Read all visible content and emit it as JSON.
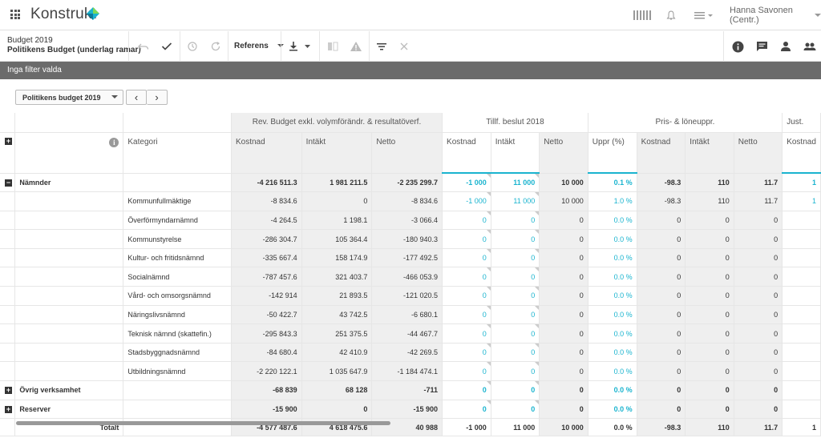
{
  "app": {
    "logo": "Konstrukt",
    "user": "Hanna Savonen (Centr.)"
  },
  "toolbar": {
    "title": "Budget 2019",
    "subtitle": "Politikens Budget (underlag ramar)",
    "referens": "Referens"
  },
  "filter": {
    "text": "Inga filter valda"
  },
  "selector": {
    "value": "Politikens budget 2019",
    "prev": "‹",
    "next": "›"
  },
  "table": {
    "category_header": "Kategori",
    "groups": [
      {
        "label": "Rev. Budget exkl. volymförändr. & resultatöverf."
      },
      {
        "label": "Tillf. beslut 2018"
      },
      {
        "label": "Pris- & löneuppr."
      },
      {
        "label": "Just."
      }
    ],
    "columns": [
      "Kostnad",
      "Intäkt",
      "Netto",
      "Kostnad",
      "Intäkt",
      "Netto",
      "Uppr (%)",
      "Kostnad",
      "Intäkt",
      "Netto",
      "Kostnad"
    ],
    "rows": [
      {
        "type": "group",
        "expand": "−",
        "label": "Nämnder",
        "cat": "",
        "values": [
          "-4 216 511.3",
          "1 981 211.5",
          "-2 235 299.7",
          "-1 000",
          "11 000",
          "10 000",
          "0.1 %",
          "-98.3",
          "110",
          "11.7",
          "1"
        ]
      },
      {
        "type": "child",
        "label": "",
        "cat": "Kommunfullmäktige",
        "values": [
          "-8 834.6",
          "0",
          "-8 834.6",
          "-1 000",
          "11 000",
          "10 000",
          "1.0 %",
          "-98.3",
          "110",
          "11.7",
          "1"
        ]
      },
      {
        "type": "child",
        "label": "",
        "cat": "Överförmyndarnämnd",
        "values": [
          "-4 264.5",
          "1 198.1",
          "-3 066.4",
          "0",
          "0",
          "0",
          "0.0 %",
          "0",
          "0",
          "0",
          ""
        ]
      },
      {
        "type": "child",
        "label": "",
        "cat": "Kommunstyrelse",
        "values": [
          "-286 304.7",
          "105 364.4",
          "-180 940.3",
          "0",
          "0",
          "0",
          "0.0 %",
          "0",
          "0",
          "0",
          ""
        ]
      },
      {
        "type": "child",
        "label": "",
        "cat": "Kultur- och fritidsnämnd",
        "values": [
          "-335 667.4",
          "158 174.9",
          "-177 492.5",
          "0",
          "0",
          "0",
          "0.0 %",
          "0",
          "0",
          "0",
          ""
        ]
      },
      {
        "type": "child",
        "label": "",
        "cat": "Socialnämnd",
        "values": [
          "-787 457.6",
          "321 403.7",
          "-466 053.9",
          "0",
          "0",
          "0",
          "0.0 %",
          "0",
          "0",
          "0",
          ""
        ]
      },
      {
        "type": "child",
        "label": "",
        "cat": "Vård- och omsorgsnämnd",
        "values": [
          "-142 914",
          "21 893.5",
          "-121 020.5",
          "0",
          "0",
          "0",
          "0.0 %",
          "0",
          "0",
          "0",
          ""
        ]
      },
      {
        "type": "child",
        "label": "",
        "cat": "Näringslivsnämnd",
        "values": [
          "-50 422.7",
          "43 742.5",
          "-6 680.1",
          "0",
          "0",
          "0",
          "0.0 %",
          "0",
          "0",
          "0",
          ""
        ]
      },
      {
        "type": "child",
        "label": "",
        "cat": "Teknisk nämnd (skattefin.)",
        "values": [
          "-295 843.3",
          "251 375.5",
          "-44 467.7",
          "0",
          "0",
          "0",
          "0.0 %",
          "0",
          "0",
          "0",
          ""
        ]
      },
      {
        "type": "child",
        "label": "",
        "cat": "Stadsbyggnadsnämnd",
        "values": [
          "-84 680.4",
          "42 410.9",
          "-42 269.5",
          "0",
          "0",
          "0",
          "0.0 %",
          "0",
          "0",
          "0",
          ""
        ]
      },
      {
        "type": "child",
        "label": "",
        "cat": "Utbildningsnämnd",
        "values": [
          "-2 220 122.1",
          "1 035 647.9",
          "-1 184 474.1",
          "0",
          "0",
          "0",
          "0.0 %",
          "0",
          "0",
          "0",
          ""
        ]
      },
      {
        "type": "group",
        "expand": "+",
        "label": "Övrig verksamhet",
        "cat": "",
        "values": [
          "-68 839",
          "68 128",
          "-711",
          "0",
          "0",
          "0",
          "0.0 %",
          "0",
          "0",
          "0",
          ""
        ]
      },
      {
        "type": "group",
        "expand": "+",
        "label": "Reserver",
        "cat": "",
        "values": [
          "-15 900",
          "0",
          "-15 900",
          "0",
          "0",
          "0",
          "0.0 %",
          "0",
          "0",
          "0",
          ""
        ]
      }
    ],
    "total": {
      "label": "Totalt",
      "values": [
        "-4 577 487.6",
        "4 618 475.6",
        "40 988",
        "-1 000",
        "11 000",
        "10 000",
        "0.0 %",
        "-98.3",
        "110",
        "11.7",
        "1"
      ]
    }
  }
}
